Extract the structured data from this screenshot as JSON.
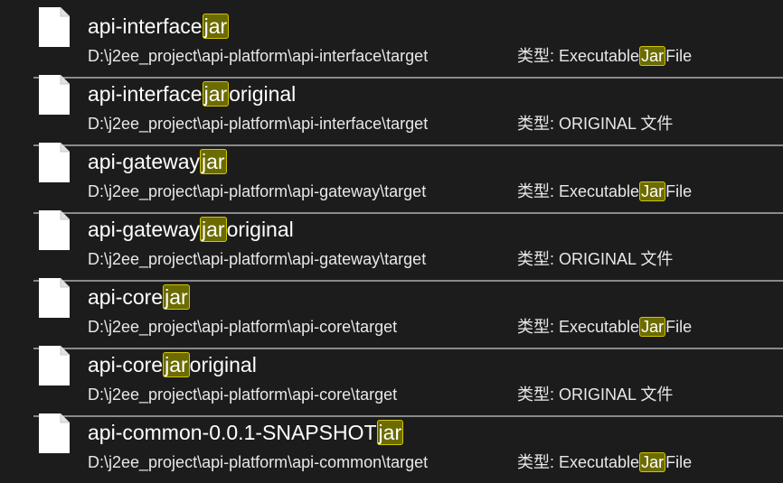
{
  "results": [
    {
      "name_pre": "api-interface",
      "name_match": "jar",
      "name_post": "",
      "path": "D:\\j2ee_project\\api-platform\\api-interface\\target",
      "type_pre": "类型: Executable",
      "type_match": "Jar",
      "type_post": "File",
      "icon": "file-icon"
    },
    {
      "name_pre": "api-interface",
      "name_match": "jar",
      "name_post": "original",
      "path": "D:\\j2ee_project\\api-platform\\api-interface\\target",
      "type_pre": "类型: ORIGINAL 文件",
      "type_match": "",
      "type_post": "",
      "icon": "file-icon"
    },
    {
      "name_pre": "api-gateway",
      "name_match": "jar",
      "name_post": "",
      "path": "D:\\j2ee_project\\api-platform\\api-gateway\\target",
      "type_pre": "类型: Executable",
      "type_match": "Jar",
      "type_post": "File",
      "icon": "file-icon"
    },
    {
      "name_pre": "api-gateway",
      "name_match": "jar",
      "name_post": "original",
      "path": "D:\\j2ee_project\\api-platform\\api-gateway\\target",
      "type_pre": "类型: ORIGINAL 文件",
      "type_match": "",
      "type_post": "",
      "icon": "file-icon"
    },
    {
      "name_pre": "api-core",
      "name_match": "jar",
      "name_post": "",
      "path": "D:\\j2ee_project\\api-platform\\api-core\\target",
      "type_pre": "类型: Executable",
      "type_match": "Jar",
      "type_post": "File",
      "icon": "file-icon"
    },
    {
      "name_pre": "api-core",
      "name_match": "jar",
      "name_post": "original",
      "path": "D:\\j2ee_project\\api-platform\\api-core\\target",
      "type_pre": "类型: ORIGINAL 文件",
      "type_match": "",
      "type_post": "",
      "icon": "file-icon"
    },
    {
      "name_pre": "api-common-0.0.1-SNAPSHOT",
      "name_match": "jar",
      "name_post": "",
      "path": "D:\\j2ee_project\\api-platform\\api-common\\target",
      "type_pre": "类型: Executable",
      "type_match": "Jar",
      "type_post": "File",
      "icon": "file-icon"
    }
  ],
  "colors": {
    "background": "#1c1c1c",
    "highlight_fill": "#6b6b00",
    "highlight_border": "#d2c400",
    "separator": "#8a8a8a"
  }
}
